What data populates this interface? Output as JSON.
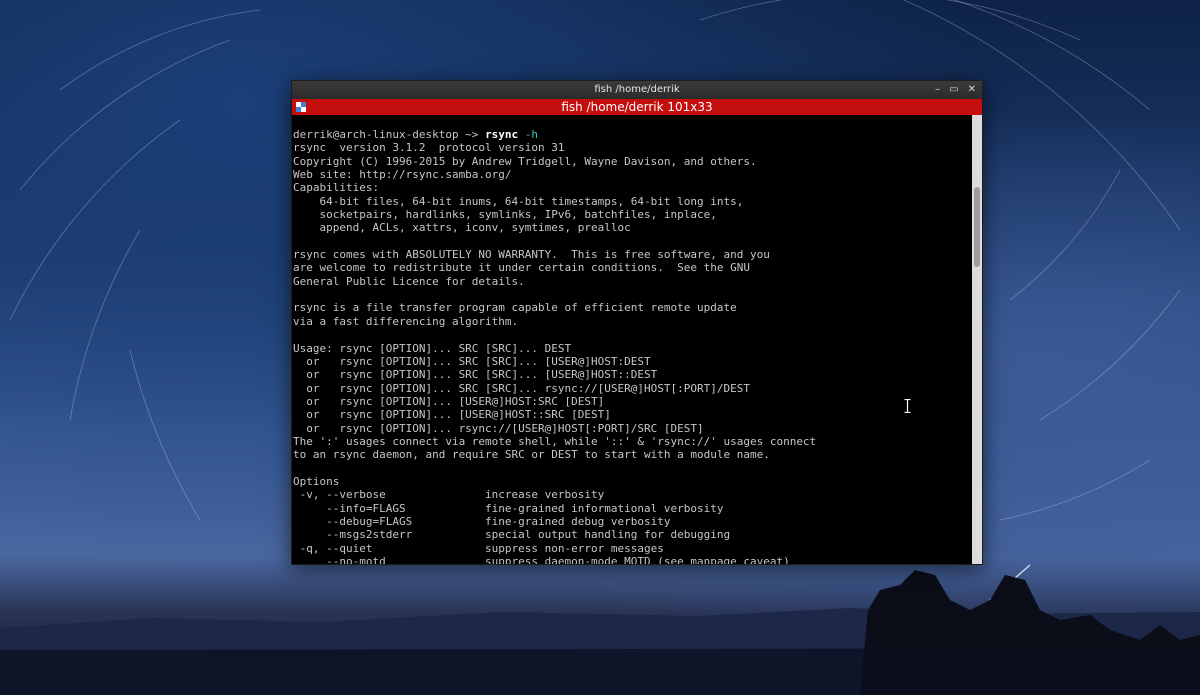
{
  "window": {
    "title": "fish  /home/derrik",
    "controls": {
      "minimize": "–",
      "maximize": "▭",
      "close": "✕"
    }
  },
  "tab": {
    "title": "fish  /home/derrik 101x33"
  },
  "terminal": {
    "prompt": "derrik@arch-linux-desktop ~> ",
    "command": "rsync",
    "command_arg": " -h",
    "output": [
      "rsync  version 3.1.2  protocol version 31",
      "Copyright (C) 1996-2015 by Andrew Tridgell, Wayne Davison, and others.",
      "Web site: http://rsync.samba.org/",
      "Capabilities:",
      "    64-bit files, 64-bit inums, 64-bit timestamps, 64-bit long ints,",
      "    socketpairs, hardlinks, symlinks, IPv6, batchfiles, inplace,",
      "    append, ACLs, xattrs, iconv, symtimes, prealloc",
      "",
      "rsync comes with ABSOLUTELY NO WARRANTY.  This is free software, and you",
      "are welcome to redistribute it under certain conditions.  See the GNU",
      "General Public Licence for details.",
      "",
      "rsync is a file transfer program capable of efficient remote update",
      "via a fast differencing algorithm.",
      "",
      "Usage: rsync [OPTION]... SRC [SRC]... DEST",
      "  or   rsync [OPTION]... SRC [SRC]... [USER@]HOST:DEST",
      "  or   rsync [OPTION]... SRC [SRC]... [USER@]HOST::DEST",
      "  or   rsync [OPTION]... SRC [SRC]... rsync://[USER@]HOST[:PORT]/DEST",
      "  or   rsync [OPTION]... [USER@]HOST:SRC [DEST]",
      "  or   rsync [OPTION]... [USER@]HOST::SRC [DEST]",
      "  or   rsync [OPTION]... rsync://[USER@]HOST[:PORT]/SRC [DEST]",
      "The ':' usages connect via remote shell, while '::' & 'rsync://' usages connect",
      "to an rsync daemon, and require SRC or DEST to start with a module name.",
      "",
      "Options",
      " -v, --verbose               increase verbosity",
      "     --info=FLAGS            fine-grained informational verbosity",
      "     --debug=FLAGS           fine-grained debug verbosity",
      "     --msgs2stderr           special output handling for debugging",
      " -q, --quiet                 suppress non-error messages",
      "     --no-motd               suppress daemon-mode MOTD (see manpage caveat)"
    ]
  },
  "icons": {
    "tab": "terminal-tab-icon",
    "cursor": "ibeam-cursor-icon"
  },
  "colors": {
    "tabbar": "#c40d0d",
    "terminal_bg": "#000000",
    "terminal_fg": "#c6c6c6",
    "command_arg": "#3ac9c9"
  }
}
